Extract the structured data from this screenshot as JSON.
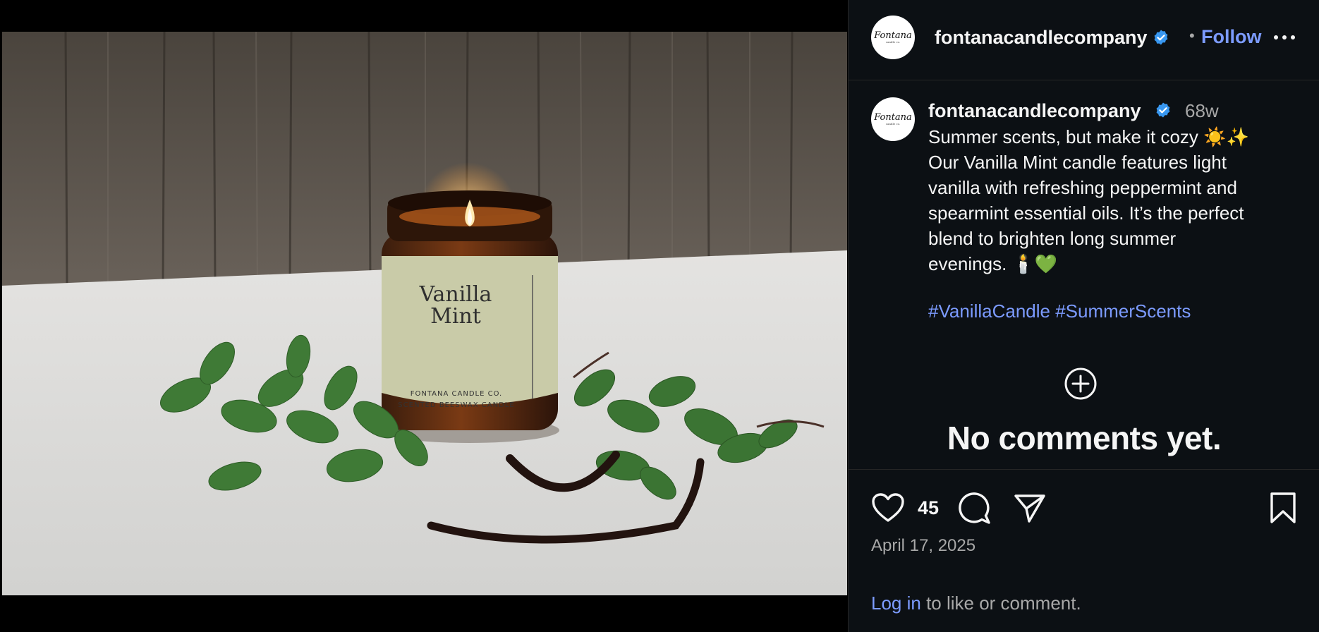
{
  "post": {
    "username": "fontanacandlecompany",
    "avatar_logo_text": "Fontana",
    "avatar_logo_sub": "candle co.",
    "separator": "•",
    "follow_label": "Follow",
    "time_ago": "68w",
    "caption_lines": [
      "Summer scents, but make it cozy ☀️✨",
      "Our Vanilla Mint candle features light",
      "vanilla with refreshing peppermint and",
      "spearmint essential oils. It’s the perfect",
      "blend to brighten long summer",
      "evenings. 🕯️💚"
    ],
    "hashtags": [
      "#VanillaCandle",
      "#SummerScents"
    ],
    "no_comments_text": "No comments yet.",
    "likes_count": "45",
    "date": "April 17, 2025",
    "login_link": "Log in",
    "login_rest": " to like or comment."
  },
  "image": {
    "label_line1": "Vanilla",
    "label_line2": "Mint",
    "label_brand": "FONTANA CANDLE CO.",
    "label_desc": "SCENTED BEESWAX CANDLE"
  },
  "icons": {
    "more": "more-options-icon",
    "verified": "verified-badge-icon",
    "add_comment": "add-circle-icon",
    "like": "heart-icon",
    "comment": "comment-bubble-icon",
    "share": "paper-plane-icon",
    "save": "bookmark-icon"
  },
  "colors": {
    "panel_bg": "#0c1014",
    "accent_link": "#7c9bff",
    "verified": "#3897f0",
    "muted_text": "#a8a8a8"
  }
}
